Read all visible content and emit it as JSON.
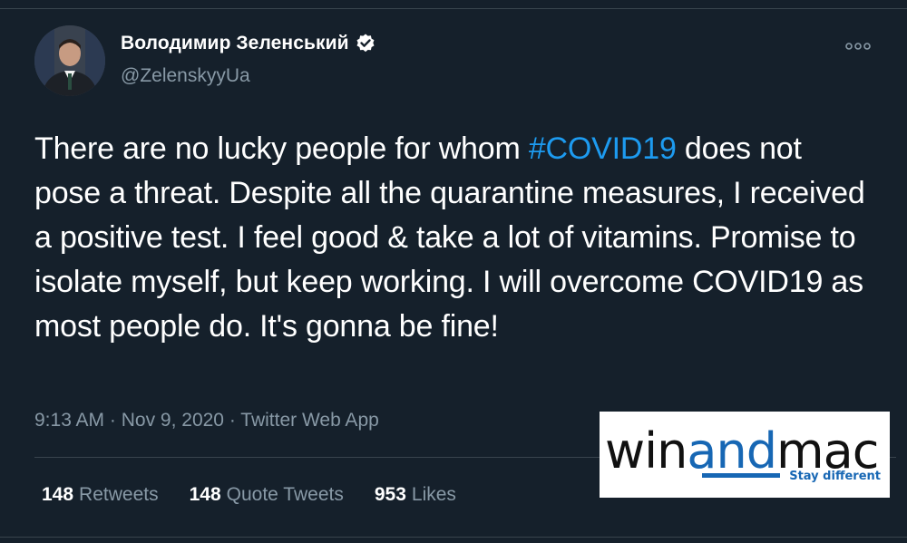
{
  "tweet": {
    "author": {
      "display_name": "Володимир Зеленський",
      "handle": "@ZelenskyyUa",
      "verified_icon": "verified-badge-icon",
      "avatar": "avatar-photo"
    },
    "more_icon": "more-options-icon",
    "text": {
      "part1": "There are no lucky people for whom ",
      "hashtag": "#COVID19",
      "part2": " does not pose a threat. Despite all the quarantine measures, I received a positive test. I feel good & take a lot of vitamins. Promise to isolate myself, but keep working. I will overcome COVID19 as most people do. It's gonna be fine!"
    },
    "meta": {
      "time": "9:13 AM",
      "date": "Nov 9, 2020",
      "source": "Twitter Web App",
      "separator": " · "
    },
    "stats": {
      "retweets_count": "148",
      "retweets_label": "Retweets",
      "quote_count": "148",
      "quote_label": "Quote Tweets",
      "likes_count": "953",
      "likes_label": "Likes"
    }
  },
  "watermark": {
    "word_start": "win",
    "word_mid": "and",
    "word_end": "mac",
    "tagline": "Stay different"
  },
  "colors": {
    "background": "#15202b",
    "accent": "#1d9bf0",
    "secondary_text": "#8899a6",
    "border": "#38444d",
    "watermark_blue": "#1767b4"
  }
}
